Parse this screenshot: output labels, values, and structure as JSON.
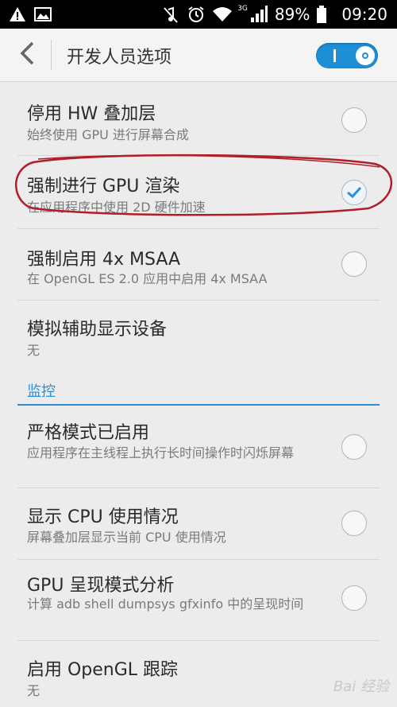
{
  "status_bar": {
    "network": "3G",
    "battery": "89%",
    "time": "09:20",
    "icons": [
      "warning-icon",
      "image-icon",
      "mute-icon",
      "alarm-icon",
      "wifi-icon",
      "signal-icon",
      "battery-icon"
    ]
  },
  "app_bar": {
    "back_icon": "chevron-left-icon",
    "title": "开发人员选项",
    "master_switch_on": true
  },
  "settings": [
    {
      "title": "停用 HW 叠加层",
      "subtitle": "始终使用 GPU 进行屏幕合成",
      "checked": false
    },
    {
      "title": "强制进行 GPU 渲染",
      "subtitle": "在应用程序中使用 2D 硬件加速",
      "checked": true
    },
    {
      "title": "强制启用 4x MSAA",
      "subtitle": "在 OpenGL ES 2.0 应用中启用 4x MSAA",
      "checked": false
    },
    {
      "title": "模拟辅助显示设备",
      "subtitle": "无"
    }
  ],
  "monitoring": {
    "header": "监控",
    "items": [
      {
        "title": "严格模式已启用",
        "subtitle": "应用程序在主线程上执行长时间操作时闪烁屏幕",
        "checked": false
      },
      {
        "title": "显示 CPU 使用情况",
        "subtitle": "屏幕叠加层显示当前 CPU 使用情况",
        "checked": false
      },
      {
        "title": "GPU 呈现模式分析",
        "subtitle": "计算 adb shell dumpsys gfxinfo 中的呈现时间",
        "checked": false
      },
      {
        "title": "启用 OpenGL 跟踪",
        "subtitle": "无"
      }
    ]
  },
  "colors": {
    "accent": "#2a8fd6",
    "annotation": "#b01e2a"
  },
  "watermark": "Bai 经验"
}
